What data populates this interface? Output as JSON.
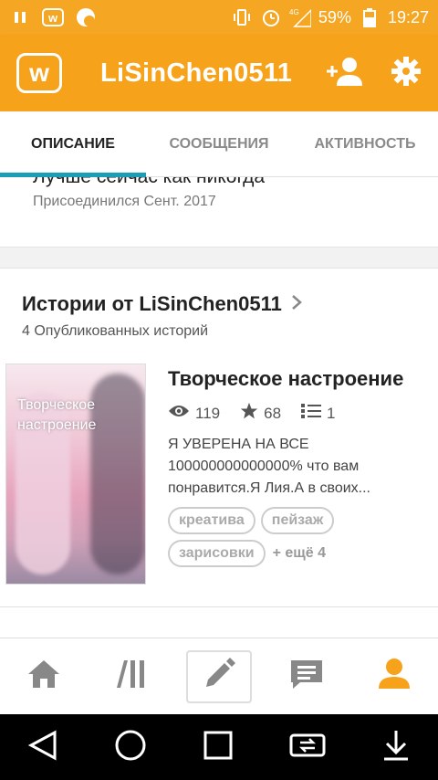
{
  "status_bar": {
    "signal_label": "4G",
    "battery": "59%",
    "time": "19:27"
  },
  "app_bar": {
    "logo_letter": "w",
    "title": "LiSinChen0511"
  },
  "tabs": [
    {
      "label": "ОПИСАНИЕ",
      "active": true
    },
    {
      "label": "СООБЩЕНИЯ",
      "active": false
    },
    {
      "label": "АКТИВНОСТЬ",
      "active": false
    }
  ],
  "about": {
    "tagline": "Лучше сейчас как никогда",
    "joined": "Присоединился Сент. 2017"
  },
  "stories": {
    "title": "Истории от LiSinChen0511",
    "subtitle": "4 Опубликованных историй",
    "items": [
      {
        "cover_text": "Творческое настроение",
        "title": "Творческое настроение",
        "reads": "119",
        "votes": "68",
        "parts": "1",
        "description": "Я УВЕРЕНА НА ВСЕ 100000000000000% что вам понравится.Я Лия.А в своих...",
        "tags": [
          "креатива",
          "пейзаж",
          "зарисовки"
        ],
        "more_tags": "+ ещё 4"
      }
    ]
  },
  "colors": {
    "accent": "#f7a21b",
    "tab_indicator": "#1a9eb8"
  }
}
